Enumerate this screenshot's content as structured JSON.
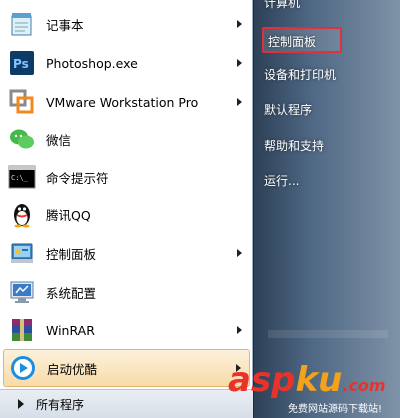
{
  "programs": [
    {
      "label": "记事本",
      "icon": "notepad-icon",
      "has_submenu": true
    },
    {
      "label": "Photoshop.exe",
      "icon": "photoshop-icon",
      "has_submenu": true
    },
    {
      "label": "VMware Workstation Pro",
      "icon": "vmware-icon",
      "has_submenu": true
    },
    {
      "label": "微信",
      "icon": "wechat-icon",
      "has_submenu": false
    },
    {
      "label": "命令提示符",
      "icon": "command-prompt-icon",
      "has_submenu": false
    },
    {
      "label": "腾讯QQ",
      "icon": "qq-penguin-icon",
      "has_submenu": false
    },
    {
      "label": "控制面板",
      "icon": "control-panel-icon",
      "has_submenu": true
    },
    {
      "label": "系统配置",
      "icon": "system-config-icon",
      "has_submenu": false
    },
    {
      "label": "WinRAR",
      "icon": "winrar-icon",
      "has_submenu": true
    },
    {
      "label": "启动优酷",
      "icon": "youku-icon",
      "has_submenu": true,
      "selected": true
    }
  ],
  "all_programs_label": "所有程序",
  "right_items": [
    {
      "label": "计算机"
    },
    {
      "label": "控制面板",
      "highlighted": true
    },
    {
      "label": "设备和打印机"
    },
    {
      "label": "默认程序"
    },
    {
      "label": "帮助和支持"
    },
    {
      "label": "运行..."
    }
  ],
  "watermark": {
    "logo_a": "asp",
    "logo_b": "ku",
    "logo_c": ".com",
    "sub": "免费网站源码下载站!"
  },
  "colors": {
    "highlight_border": "#e0303a",
    "selected_bg": "#f8dba8",
    "watermark_red": "#e8322a",
    "watermark_orange": "#f5a21b"
  }
}
